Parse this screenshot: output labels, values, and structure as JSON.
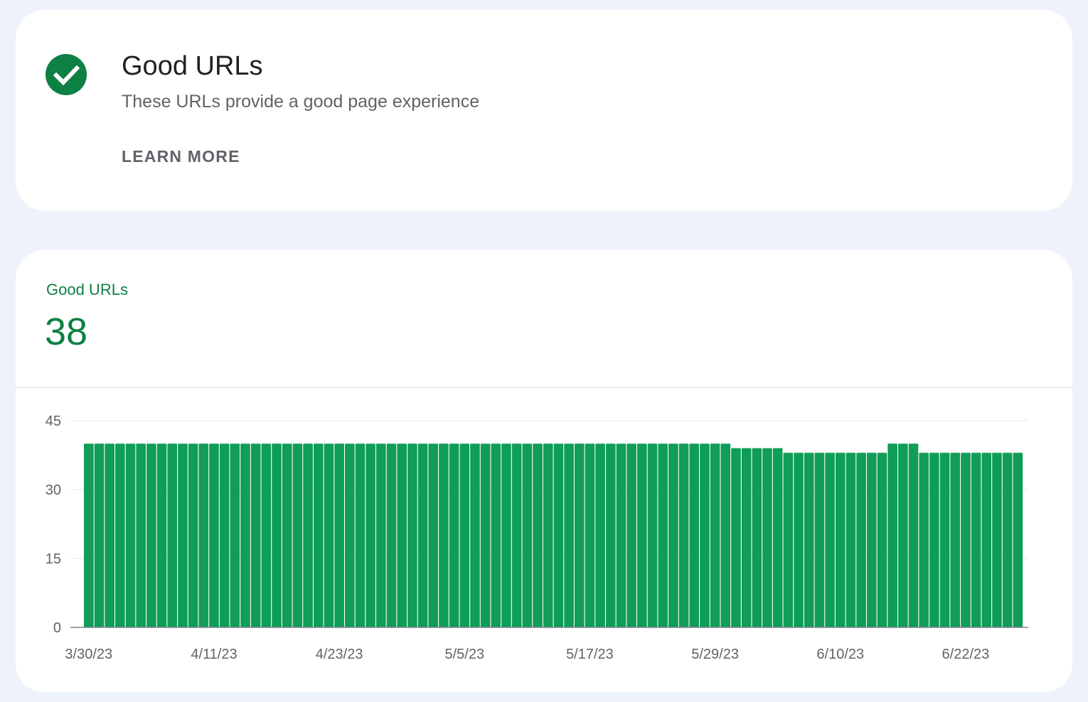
{
  "status_card": {
    "icon": "check-circle-icon",
    "title": "Good URLs",
    "subtitle": "These URLs provide a good page experience",
    "learn_more_label": "LEARN MORE"
  },
  "metric": {
    "label": "Good URLs",
    "value": "38"
  },
  "colors": {
    "accent": "#0d8043",
    "bar": "#0f9d58",
    "axis": "#5f6368",
    "grid": "#e8eaed"
  },
  "chart_data": {
    "type": "bar",
    "series": [
      {
        "name": "Good URLs",
        "color": "#0f9d58"
      }
    ],
    "x_start_date": "3/30/23",
    "xtick_labels": [
      "3/30/23",
      "4/11/23",
      "4/23/23",
      "5/5/23",
      "5/17/23",
      "5/29/23",
      "6/10/23",
      "6/22/23"
    ],
    "yticks": [
      0,
      15,
      30,
      45
    ],
    "ylim": [
      0,
      45
    ],
    "grid": true,
    "values": [
      40,
      40,
      40,
      40,
      40,
      40,
      40,
      40,
      40,
      40,
      40,
      40,
      40,
      40,
      40,
      40,
      40,
      40,
      40,
      40,
      40,
      40,
      40,
      40,
      40,
      40,
      40,
      40,
      40,
      40,
      40,
      40,
      40,
      40,
      40,
      40,
      40,
      40,
      40,
      40,
      40,
      40,
      40,
      40,
      40,
      40,
      40,
      40,
      40,
      40,
      40,
      40,
      40,
      40,
      40,
      40,
      40,
      40,
      40,
      40,
      40,
      40,
      39,
      39,
      39,
      39,
      39,
      38,
      38,
      38,
      38,
      38,
      38,
      38,
      38,
      38,
      38,
      40,
      40,
      40,
      38,
      38,
      38,
      38,
      38,
      38,
      38,
      38,
      38,
      38
    ]
  }
}
